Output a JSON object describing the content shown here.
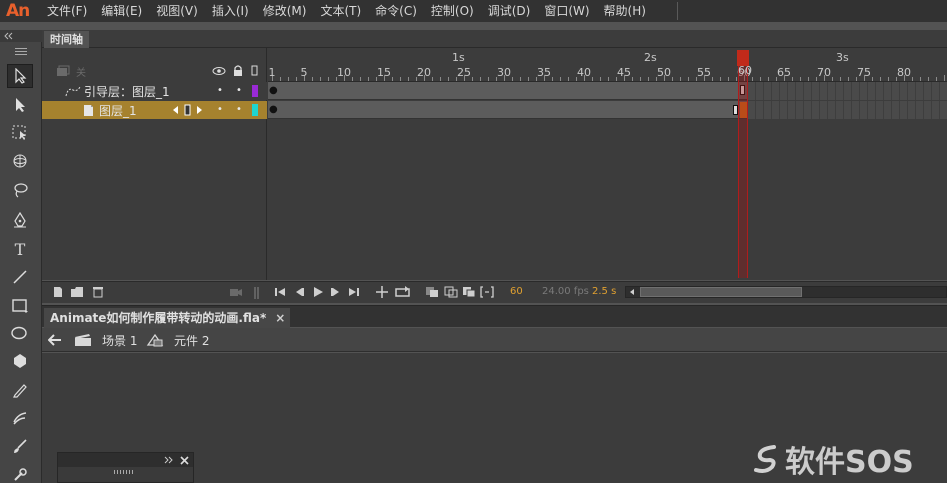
{
  "app": {
    "logo": "An"
  },
  "menu": [
    "文件(F)",
    "编辑(E)",
    "视图(V)",
    "插入(I)",
    "修改(M)",
    "文本(T)",
    "命令(C)",
    "控制(O)",
    "调试(D)",
    "窗口(W)",
    "帮助(H)"
  ],
  "timeline": {
    "tab_label": "时间轴",
    "layers": [
      {
        "name": "引导层：图层_1",
        "color": "#9a2ad6",
        "selected": false
      },
      {
        "name": "图层_1",
        "color": "#20d6d0",
        "selected": true
      }
    ],
    "seconds": [
      "1s",
      "2s",
      "3s"
    ],
    "frame_numbers": [
      "1",
      "5",
      "10",
      "15",
      "20",
      "25",
      "30",
      "35",
      "40",
      "45",
      "50",
      "55",
      "60",
      "65",
      "70",
      "75",
      "80"
    ],
    "current_frame": "60",
    "fps": "24.00 fps",
    "time": "2.5 s"
  },
  "document": {
    "tab_label": "Animate如何制作履带转动的动画.fla*",
    "close_glyph": "×"
  },
  "editbar": {
    "scene": "场景 1",
    "symbol": "元件 2"
  },
  "watermark": {
    "text": "软件SOS"
  },
  "colors": {
    "accent": "#e8602c",
    "selected_layer": "#a6822e",
    "playhead": "#c12a1a"
  }
}
